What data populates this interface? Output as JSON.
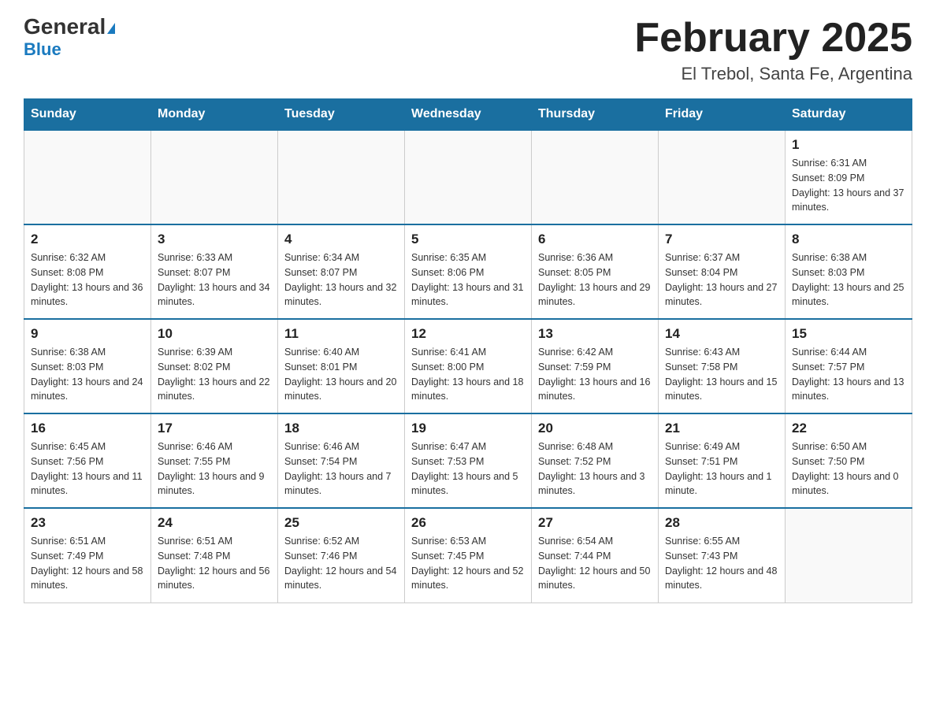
{
  "header": {
    "logo_general": "General",
    "logo_blue": "Blue",
    "title": "February 2025",
    "subtitle": "El Trebol, Santa Fe, Argentina"
  },
  "weekdays": [
    "Sunday",
    "Monday",
    "Tuesday",
    "Wednesday",
    "Thursday",
    "Friday",
    "Saturday"
  ],
  "weeks": [
    [
      {
        "day": "",
        "info": ""
      },
      {
        "day": "",
        "info": ""
      },
      {
        "day": "",
        "info": ""
      },
      {
        "day": "",
        "info": ""
      },
      {
        "day": "",
        "info": ""
      },
      {
        "day": "",
        "info": ""
      },
      {
        "day": "1",
        "info": "Sunrise: 6:31 AM\nSunset: 8:09 PM\nDaylight: 13 hours and 37 minutes."
      }
    ],
    [
      {
        "day": "2",
        "info": "Sunrise: 6:32 AM\nSunset: 8:08 PM\nDaylight: 13 hours and 36 minutes."
      },
      {
        "day": "3",
        "info": "Sunrise: 6:33 AM\nSunset: 8:07 PM\nDaylight: 13 hours and 34 minutes."
      },
      {
        "day": "4",
        "info": "Sunrise: 6:34 AM\nSunset: 8:07 PM\nDaylight: 13 hours and 32 minutes."
      },
      {
        "day": "5",
        "info": "Sunrise: 6:35 AM\nSunset: 8:06 PM\nDaylight: 13 hours and 31 minutes."
      },
      {
        "day": "6",
        "info": "Sunrise: 6:36 AM\nSunset: 8:05 PM\nDaylight: 13 hours and 29 minutes."
      },
      {
        "day": "7",
        "info": "Sunrise: 6:37 AM\nSunset: 8:04 PM\nDaylight: 13 hours and 27 minutes."
      },
      {
        "day": "8",
        "info": "Sunrise: 6:38 AM\nSunset: 8:03 PM\nDaylight: 13 hours and 25 minutes."
      }
    ],
    [
      {
        "day": "9",
        "info": "Sunrise: 6:38 AM\nSunset: 8:03 PM\nDaylight: 13 hours and 24 minutes."
      },
      {
        "day": "10",
        "info": "Sunrise: 6:39 AM\nSunset: 8:02 PM\nDaylight: 13 hours and 22 minutes."
      },
      {
        "day": "11",
        "info": "Sunrise: 6:40 AM\nSunset: 8:01 PM\nDaylight: 13 hours and 20 minutes."
      },
      {
        "day": "12",
        "info": "Sunrise: 6:41 AM\nSunset: 8:00 PM\nDaylight: 13 hours and 18 minutes."
      },
      {
        "day": "13",
        "info": "Sunrise: 6:42 AM\nSunset: 7:59 PM\nDaylight: 13 hours and 16 minutes."
      },
      {
        "day": "14",
        "info": "Sunrise: 6:43 AM\nSunset: 7:58 PM\nDaylight: 13 hours and 15 minutes."
      },
      {
        "day": "15",
        "info": "Sunrise: 6:44 AM\nSunset: 7:57 PM\nDaylight: 13 hours and 13 minutes."
      }
    ],
    [
      {
        "day": "16",
        "info": "Sunrise: 6:45 AM\nSunset: 7:56 PM\nDaylight: 13 hours and 11 minutes."
      },
      {
        "day": "17",
        "info": "Sunrise: 6:46 AM\nSunset: 7:55 PM\nDaylight: 13 hours and 9 minutes."
      },
      {
        "day": "18",
        "info": "Sunrise: 6:46 AM\nSunset: 7:54 PM\nDaylight: 13 hours and 7 minutes."
      },
      {
        "day": "19",
        "info": "Sunrise: 6:47 AM\nSunset: 7:53 PM\nDaylight: 13 hours and 5 minutes."
      },
      {
        "day": "20",
        "info": "Sunrise: 6:48 AM\nSunset: 7:52 PM\nDaylight: 13 hours and 3 minutes."
      },
      {
        "day": "21",
        "info": "Sunrise: 6:49 AM\nSunset: 7:51 PM\nDaylight: 13 hours and 1 minute."
      },
      {
        "day": "22",
        "info": "Sunrise: 6:50 AM\nSunset: 7:50 PM\nDaylight: 13 hours and 0 minutes."
      }
    ],
    [
      {
        "day": "23",
        "info": "Sunrise: 6:51 AM\nSunset: 7:49 PM\nDaylight: 12 hours and 58 minutes."
      },
      {
        "day": "24",
        "info": "Sunrise: 6:51 AM\nSunset: 7:48 PM\nDaylight: 12 hours and 56 minutes."
      },
      {
        "day": "25",
        "info": "Sunrise: 6:52 AM\nSunset: 7:46 PM\nDaylight: 12 hours and 54 minutes."
      },
      {
        "day": "26",
        "info": "Sunrise: 6:53 AM\nSunset: 7:45 PM\nDaylight: 12 hours and 52 minutes."
      },
      {
        "day": "27",
        "info": "Sunrise: 6:54 AM\nSunset: 7:44 PM\nDaylight: 12 hours and 50 minutes."
      },
      {
        "day": "28",
        "info": "Sunrise: 6:55 AM\nSunset: 7:43 PM\nDaylight: 12 hours and 48 minutes."
      },
      {
        "day": "",
        "info": ""
      }
    ]
  ]
}
